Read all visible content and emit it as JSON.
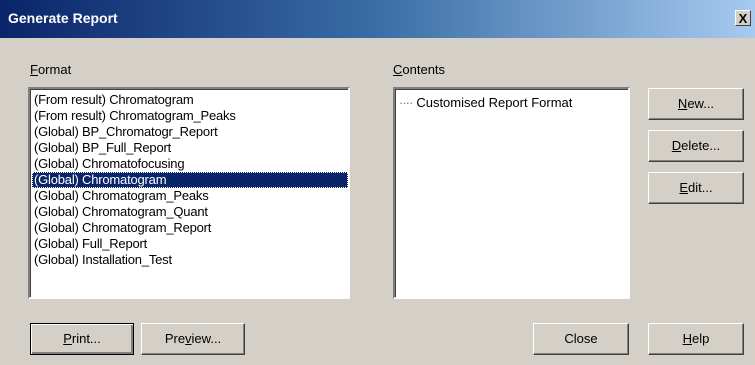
{
  "window": {
    "title": "Generate Report",
    "close_glyph": "X"
  },
  "format": {
    "label": "Format",
    "items": [
      "(From result) Chromatogram",
      "(From result) Chromatogram_Peaks",
      "(Global) BP_Chromatogr_Report",
      "(Global) BP_Full_Report",
      "(Global) Chromatofocusing",
      "(Global) Chromatogram",
      "(Global) Chromatogram_Peaks",
      "(Global) Chromatogram_Quant",
      "(Global) Chromatogram_Report",
      "(Global) Full_Report",
      "(Global) Installation_Test"
    ],
    "selected": "(Global) Chromatogram"
  },
  "contents": {
    "label": "Contents",
    "tree_item": "Customised Report Format"
  },
  "buttons": {
    "new": "New...",
    "delete": "Delete...",
    "edit": "Edit...",
    "print": "Print...",
    "preview": "Preview...",
    "close": "Close",
    "help": "Help"
  },
  "colors": {
    "selection": "#0a246a",
    "face": "#d4d0c8",
    "title_start": "#0a246a",
    "title_end": "#a6caf0"
  }
}
